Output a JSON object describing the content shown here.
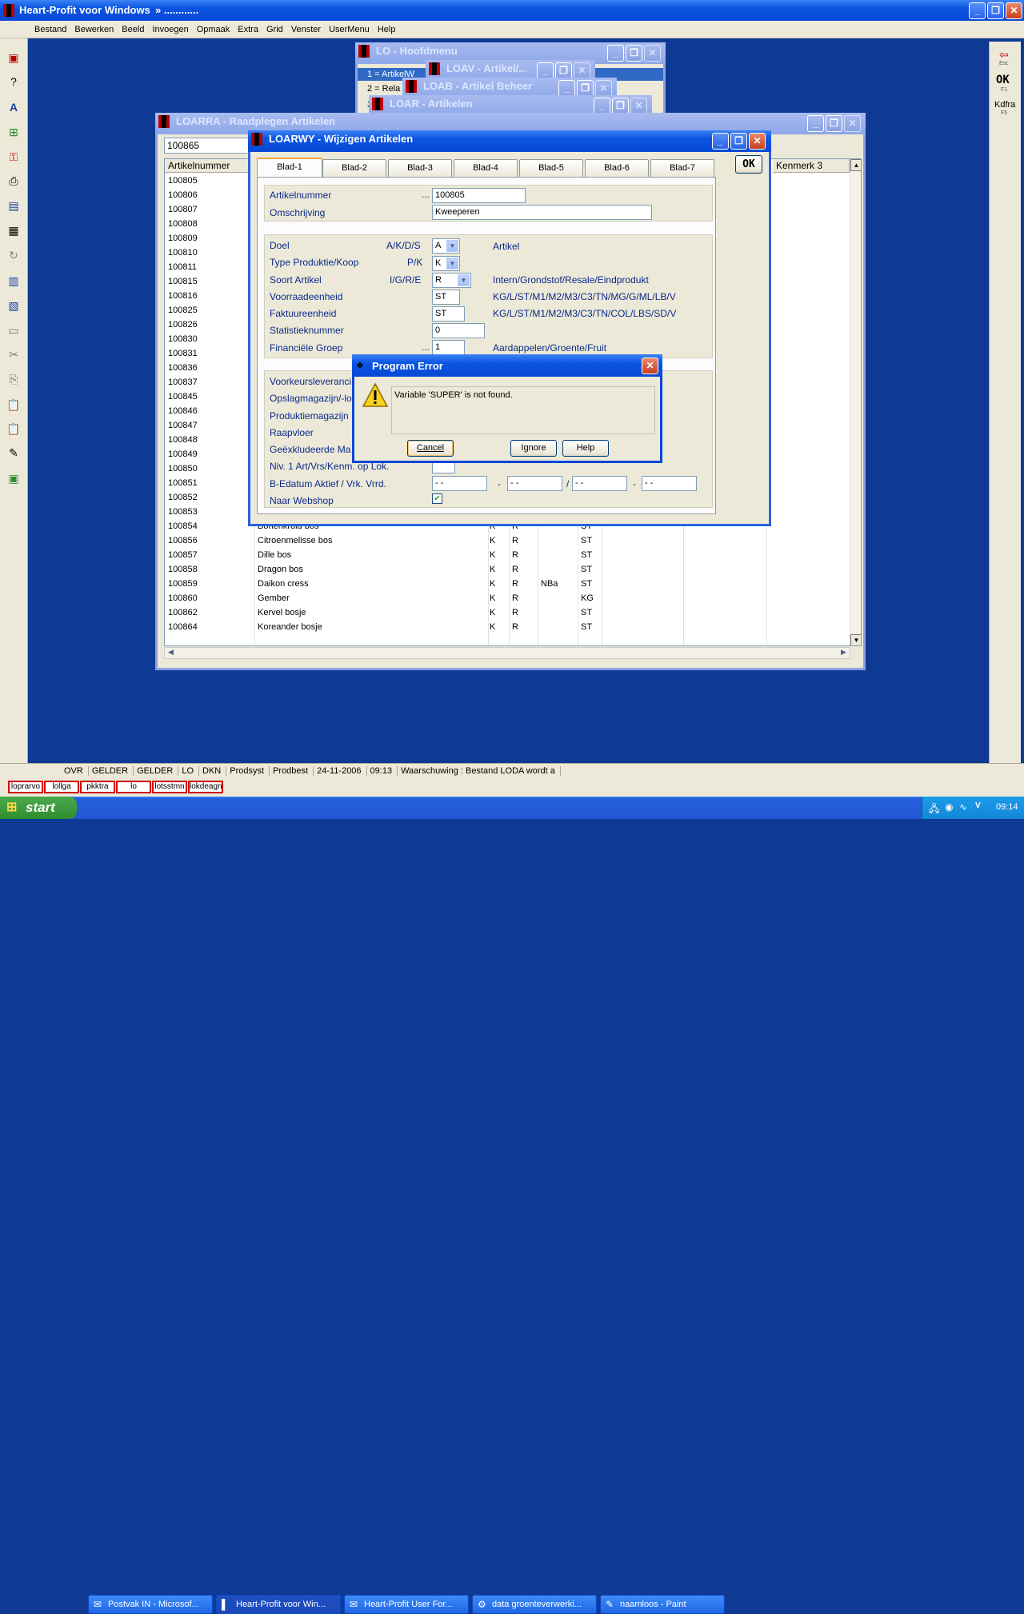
{
  "app": {
    "title": "Heart-Profit voor Windows",
    "title_suffix": "»  ............"
  },
  "menu": [
    "Bestand",
    "Bewerken",
    "Beeld",
    "Invoegen",
    "Opmaak",
    "Extra",
    "Grid",
    "Venster",
    "UserMenu",
    "Help"
  ],
  "right_toolbar": {
    "esc": "Esc",
    "ok": "OK",
    "f1": "F1",
    "kdfra": "Kdfra",
    "f5": "F5"
  },
  "windows": {
    "lo": {
      "title": "LO - Hoofdmenu",
      "items": [
        "1 = ArtikelW",
        "2 = Rela",
        "3"
      ]
    },
    "loav": {
      "title": "LOAV - Artikel/..."
    },
    "loab": {
      "title": "LOAB - Artikel Beheer"
    },
    "loar": {
      "title": "LOAR - Artikelen"
    },
    "loarra": {
      "title": "LOARRA - Raadplegen Artikelen",
      "search_value": "100865",
      "columns": [
        "Artikelnummer",
        "Kenmerk 3"
      ],
      "rows": [
        {
          "nr": "100805",
          "oms": "",
          "a": "",
          "b": "",
          "c": "",
          "d": ""
        },
        {
          "nr": "100806",
          "oms": "",
          "a": "",
          "b": "",
          "c": "",
          "d": ""
        },
        {
          "nr": "100807",
          "oms": "",
          "a": "",
          "b": "",
          "c": "",
          "d": ""
        },
        {
          "nr": "100808",
          "oms": "",
          "a": "",
          "b": "",
          "c": "",
          "d": ""
        },
        {
          "nr": "100809",
          "oms": "",
          "a": "",
          "b": "",
          "c": "",
          "d": ""
        },
        {
          "nr": "100810",
          "oms": "",
          "a": "",
          "b": "",
          "c": "",
          "d": ""
        },
        {
          "nr": "100811",
          "oms": "",
          "a": "",
          "b": "",
          "c": "",
          "d": ""
        },
        {
          "nr": "100815",
          "oms": "",
          "a": "",
          "b": "",
          "c": "",
          "d": ""
        },
        {
          "nr": "100816",
          "oms": "",
          "a": "",
          "b": "",
          "c": "",
          "d": ""
        },
        {
          "nr": "100825",
          "oms": "",
          "a": "",
          "b": "",
          "c": "",
          "d": ""
        },
        {
          "nr": "100826",
          "oms": "",
          "a": "",
          "b": "",
          "c": "",
          "d": ""
        },
        {
          "nr": "100830",
          "oms": "",
          "a": "",
          "b": "",
          "c": "",
          "d": ""
        },
        {
          "nr": "100831",
          "oms": "",
          "a": "",
          "b": "",
          "c": "",
          "d": ""
        },
        {
          "nr": "100836",
          "oms": "",
          "a": "",
          "b": "",
          "c": "",
          "d": ""
        },
        {
          "nr": "100837",
          "oms": "",
          "a": "",
          "b": "",
          "c": "",
          "d": ""
        },
        {
          "nr": "100845",
          "oms": "",
          "a": "",
          "b": "",
          "c": "",
          "d": ""
        },
        {
          "nr": "100846",
          "oms": "",
          "a": "",
          "b": "",
          "c": "",
          "d": ""
        },
        {
          "nr": "100847",
          "oms": "",
          "a": "",
          "b": "",
          "c": "",
          "d": ""
        },
        {
          "nr": "100848",
          "oms": "",
          "a": "",
          "b": "",
          "c": "",
          "d": ""
        },
        {
          "nr": "100849",
          "oms": "",
          "a": "",
          "b": "",
          "c": "",
          "d": ""
        },
        {
          "nr": "100850",
          "oms": "",
          "a": "",
          "b": "",
          "c": "",
          "d": ""
        },
        {
          "nr": "100851",
          "oms": "",
          "a": "",
          "b": "",
          "c": "",
          "d": ""
        },
        {
          "nr": "100852",
          "oms": "",
          "a": "",
          "b": "",
          "c": "",
          "d": ""
        },
        {
          "nr": "100853",
          "oms": "",
          "a": "",
          "b": "",
          "c": "",
          "d": ""
        },
        {
          "nr": "100854",
          "oms": "Bonenkruid bos",
          "a": "K",
          "b": "R",
          "c": "",
          "d": "ST"
        },
        {
          "nr": "100856",
          "oms": "Citroenmelisse bos",
          "a": "K",
          "b": "R",
          "c": "",
          "d": "ST"
        },
        {
          "nr": "100857",
          "oms": "Dille bos",
          "a": "K",
          "b": "R",
          "c": "",
          "d": "ST"
        },
        {
          "nr": "100858",
          "oms": "Dragon bos",
          "a": "K",
          "b": "R",
          "c": "",
          "d": "ST"
        },
        {
          "nr": "100859",
          "oms": "Daikon cress",
          "a": "K",
          "b": "R",
          "c": "NBa",
          "d": "ST"
        },
        {
          "nr": "100860",
          "oms": "Gember",
          "a": "K",
          "b": "R",
          "c": "",
          "d": "KG"
        },
        {
          "nr": "100862",
          "oms": "Kervel bosje",
          "a": "K",
          "b": "R",
          "c": "",
          "d": "ST"
        },
        {
          "nr": "100864",
          "oms": "Koreander bosje",
          "a": "K",
          "b": "R",
          "c": "",
          "d": "ST"
        }
      ]
    },
    "loarwy": {
      "title": "LOARWY - Wijzigen Artikelen",
      "ok": "OK",
      "tabs": [
        "Blad-1",
        "Blad-2",
        "Blad-3",
        "Blad-4",
        "Blad-5",
        "Blad-6",
        "Blad-7"
      ],
      "artikelnummer_label": "Artikelnummer",
      "artikelnummer": "100805",
      "omschrijving_label": "Omschrijving",
      "omschrijving": "Kweeperen",
      "dots": "...",
      "doel": {
        "label": "Doel",
        "codes": "A/K/D/S",
        "value": "A",
        "desc": "Artikel"
      },
      "type": {
        "label": "Type Produktie/Koop",
        "codes": "P/K",
        "value": "K"
      },
      "soort": {
        "label": "Soort Artikel",
        "codes": "I/G/R/E",
        "value": "R",
        "desc": "Intern/Grondstof/Resale/Eindprodukt"
      },
      "voorraad": {
        "label": "Voorraadeenheid",
        "value": "ST",
        "desc": "KG/L/ST/M1/M2/M3/C3/TN/MG/G/ML/LB/V"
      },
      "faktuur": {
        "label": "Faktuureenheid",
        "value": "ST",
        "desc": "KG/L/ST/M1/M2/M3/C3/TN/COL/LBS/SD/V"
      },
      "statistiek": {
        "label": "Statistieknummer",
        "value": "0"
      },
      "financiele": {
        "label": "Financiële Groep",
        "value": "1",
        "desc": "Aardappelen/Groente/Fruit"
      },
      "lower": [
        "Voorkeursleveranci",
        "Opslagmagazijn/-lo",
        "Produktiemagazijn",
        "Raapvloer",
        "Geëxkludeerde Ma",
        "Niv. 1 Art/Vrs/Kenm. op Lok.",
        "B-Edatum Aktief / Vrk. Vrrd.",
        "Naar Webshop"
      ],
      "date_placeholder": "- -",
      "date_sep": [
        "-",
        "/",
        "-"
      ]
    }
  },
  "dialog": {
    "title": "Program Error",
    "message": "Variable 'SUPER' is not found.",
    "cancel": "Cancel",
    "ignore": "Ignore",
    "help": "Help"
  },
  "statusbar": [
    "OVR",
    "GELDER",
    "GELDER",
    "LO",
    "DKN",
    "Prodsyst",
    "Prodbest",
    "24-11-2006",
    "09:13",
    "Waarschuwing : Bestand LODA wordt a"
  ],
  "quicktabs": [
    "loprarvo",
    "lollga",
    "pkktra",
    "lo",
    "lotsstmn",
    "lokdeagn"
  ],
  "taskbar": {
    "start": "start",
    "tasks": [
      "Postvak IN - Microsof...",
      "Heart-Profit voor Win...",
      "Heart-Profit User For...",
      "data groenteverwerki...",
      "naamloos - Paint"
    ],
    "clock": "09:14"
  },
  "colors": {
    "desktop": "#0e3a94",
    "xp_blue": "#0a54e1",
    "label_blue": "#0b2a8a"
  }
}
